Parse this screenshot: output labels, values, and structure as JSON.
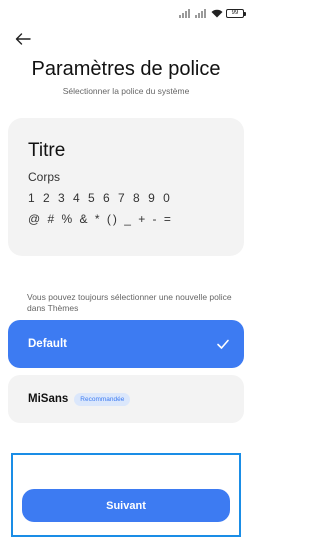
{
  "status_bar": {
    "battery": "99"
  },
  "header": {
    "title": "Paramètres de police",
    "subtitle": "Sélectionner la police du système"
  },
  "preview": {
    "title": "Titre",
    "body": "Corps",
    "digits": "1 2 3 4 5 6 7 8 9 0",
    "symbols": "@ # % & * () _ + - ="
  },
  "info_text": "Vous pouvez toujours sélectionner une nouvelle police dans Thèmes",
  "options": [
    {
      "label": "Default",
      "selected": true
    },
    {
      "label": "MiSans",
      "badge": "Recommandée",
      "selected": false
    }
  ],
  "footer": {
    "next_label": "Suivant"
  },
  "colors": {
    "accent": "#3d7bf2",
    "badge_bg": "#dbe7fb",
    "card_bg": "#f3f3f3",
    "highlight_border": "#1a8de6"
  }
}
